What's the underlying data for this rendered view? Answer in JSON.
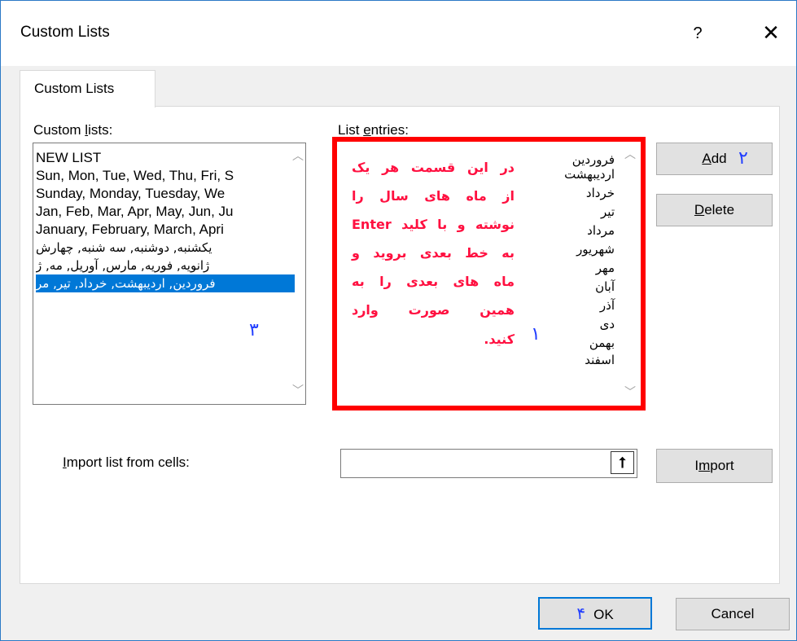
{
  "window": {
    "title": "Custom Lists",
    "help_label": "?",
    "close_label": "✕"
  },
  "tab": {
    "label": "Custom Lists"
  },
  "custom_lists": {
    "label_prefix": "Custom ",
    "label_access": "l",
    "label_suffix": "ists:",
    "items": [
      "NEW LIST",
      "Sun, Mon, Tue, Wed, Thu, Fri, S",
      "Sunday, Monday, Tuesday, We",
      "Jan, Feb, Mar, Apr, May, Jun, Ju",
      "January, February, March, Apri",
      "یکشنبه, دوشنبه, سه شنبه, چهارش",
      "ژانویه, فوریه, مارس, آوریل, مه, ژ",
      "فروردین, اردیبهشت, خرداد, تیر, مر"
    ],
    "selected_index": 7
  },
  "list_entries": {
    "label_prefix": "List ",
    "label_access": "e",
    "label_suffix": "ntries:",
    "months": [
      "فروردین",
      "اردیبهشت",
      "خرداد",
      "تیر",
      "مرداد",
      "شهریور",
      "مهر",
      "آبان",
      "آذر",
      "دی",
      "بهمن",
      "اسفند"
    ],
    "note_lines": [
      "در این قسمت هر یک",
      "از ماه های سال را",
      "نوشته و با کلید Enter",
      "به خط بعدی بروید و",
      "ماه های بعدی را به",
      "همین صورت وارد",
      "کنید."
    ]
  },
  "annotations": {
    "one": "١",
    "two": "٢",
    "three": "٣",
    "four": "۴"
  },
  "buttons": {
    "add_access": "A",
    "add_rest": "dd",
    "delete_access": "D",
    "delete_rest": "elete",
    "import_pre": "I",
    "import_access": "m",
    "import_rest": "port",
    "ok": "OK",
    "cancel": "Cancel"
  },
  "import": {
    "label_access": "I",
    "label_rest": "mport list from cells:",
    "value": "",
    "picker_glyph": "⭡"
  },
  "colors": {
    "highlight_box": "#ff0000",
    "note_text": "#ff1040",
    "annotation_blue": "#1f3cff",
    "selection": "#0078d7"
  }
}
